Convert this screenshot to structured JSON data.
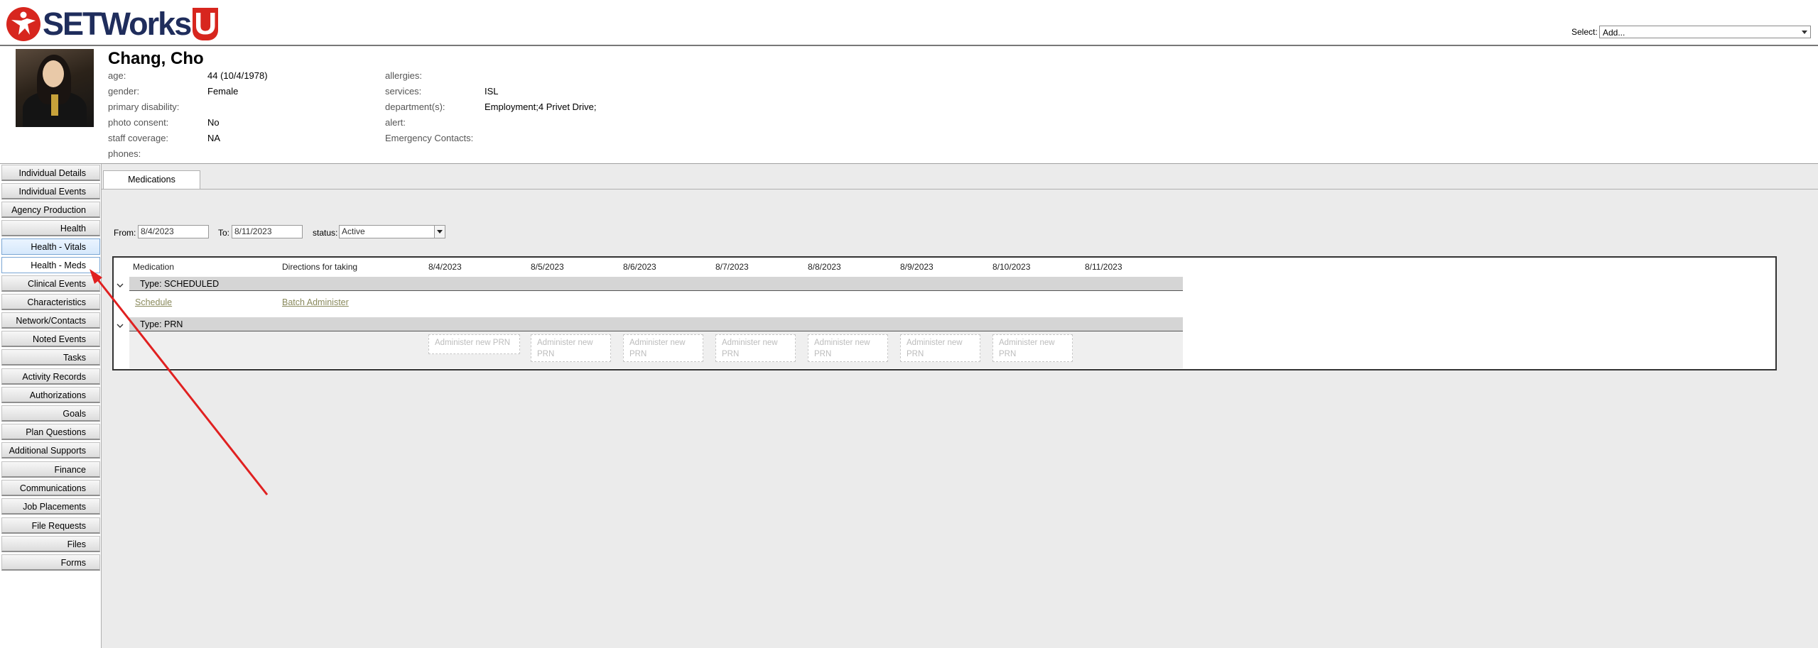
{
  "brand": {
    "name": "SETWorks",
    "suffix": "U"
  },
  "top_select": {
    "label": "Select:",
    "value": "Add..."
  },
  "person": {
    "name": "Chang, Cho",
    "left_fields": [
      {
        "label": "age:",
        "value": "44 (10/4/1978)"
      },
      {
        "label": "gender:",
        "value": "Female"
      },
      {
        "label": "primary disability:",
        "value": ""
      },
      {
        "label": "photo consent:",
        "value": "No"
      },
      {
        "label": "staff coverage:",
        "value": "NA"
      },
      {
        "label": "phones:",
        "value": ""
      }
    ],
    "right_fields": [
      {
        "label": "allergies:",
        "value": ""
      },
      {
        "label": "services:",
        "value": "ISL"
      },
      {
        "label": "department(s):",
        "value": "Employment;4 Privet Drive;"
      },
      {
        "label": "alert:",
        "value": ""
      },
      {
        "label": "Emergency Contacts:",
        "value": ""
      }
    ]
  },
  "sidebar": {
    "items": [
      "Individual Details",
      "Individual Events",
      "Agency Production",
      "Health",
      "Health - Vitals",
      "Health - Meds",
      "Clinical Events",
      "Characteristics",
      "Network/Contacts",
      "Noted Events",
      "Tasks",
      "Activity Records",
      "Authorizations",
      "Goals",
      "Plan Questions",
      "Additional Supports",
      "Finance",
      "Communications",
      "Job Placements",
      "File Requests",
      "Files",
      "Forms"
    ],
    "active": "Health - Meds"
  },
  "tabs": {
    "medications": "Medications"
  },
  "filters": {
    "from_label": "From:",
    "from_value": "8/4/2023",
    "to_label": "To:",
    "to_value": "8/11/2023",
    "status_label": "status:",
    "status_value": "Active"
  },
  "grid": {
    "headers": {
      "medication": "Medication",
      "directions": "Directions for taking",
      "dates": [
        "8/4/2023",
        "8/5/2023",
        "8/6/2023",
        "8/7/2023",
        "8/8/2023",
        "8/9/2023",
        "8/10/2023",
        "8/11/2023"
      ]
    },
    "group_scheduled": "Type: SCHEDULED",
    "schedule_link": "Schedule",
    "batch_link": "Batch Administer",
    "group_prn": "Type: PRN",
    "prn_buttons": [
      "Administer new PRN",
      "Administer new PRN",
      "Administer new PRN",
      "Administer new PRN",
      "Administer new PRN",
      "Administer new PRN",
      "Administer new PRN"
    ]
  },
  "colors": {
    "accent_red": "#e02020",
    "brand_navy": "#1f2d5c",
    "brand_red": "#d7261e"
  },
  "icons": [
    "setworks-star-logo-icon",
    "chevron-down-icon",
    "dropdown-arrow-icon",
    "annotation-arrow"
  ]
}
